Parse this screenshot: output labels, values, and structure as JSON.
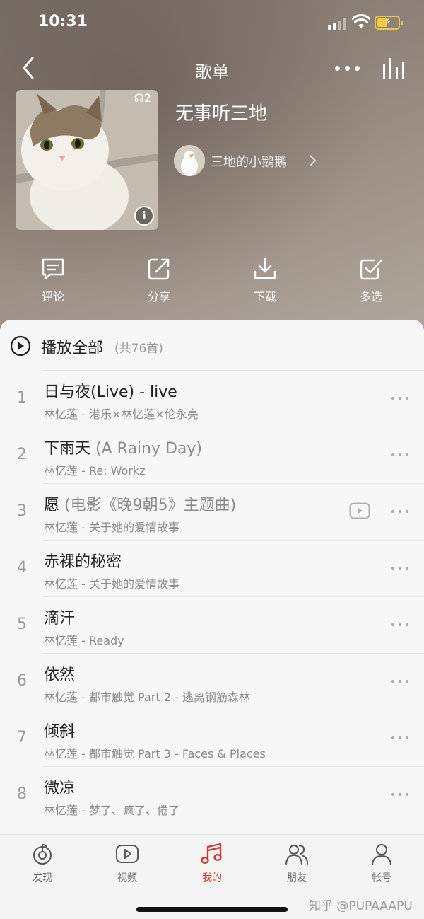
{
  "status": {
    "time": "10:31"
  },
  "nav": {
    "title": "歌单"
  },
  "playlist": {
    "title": "无事听三地",
    "play_count": "2",
    "creator": "三地的小鹅鹅"
  },
  "actions": [
    {
      "label": "评论",
      "icon": "comment-icon"
    },
    {
      "label": "分享",
      "icon": "share-icon"
    },
    {
      "label": "下载",
      "icon": "download-icon"
    },
    {
      "label": "多选",
      "icon": "multi-select-icon"
    }
  ],
  "list": {
    "play_all": "播放全部",
    "count": "(共76首)",
    "songs": [
      {
        "num": "1",
        "title": "日与夜(Live) - live",
        "extra": "",
        "sub": "林忆莲 - 港乐×林忆莲×伦永亮",
        "mv": false
      },
      {
        "num": "2",
        "title": "下雨天",
        "extra": " (A Rainy Day)",
        "sub": "林忆莲 - Re: Workz",
        "mv": false
      },
      {
        "num": "3",
        "title": "愿",
        "extra": " (电影《晚9朝5》主题曲)",
        "sub": "林忆莲 - 关于她的爱情故事",
        "mv": true
      },
      {
        "num": "4",
        "title": "赤裸的秘密",
        "extra": "",
        "sub": "林忆莲 - 关于她的爱情故事",
        "mv": false
      },
      {
        "num": "5",
        "title": "滴汗",
        "extra": "",
        "sub": "林忆莲 - Ready",
        "mv": false
      },
      {
        "num": "6",
        "title": "依然",
        "extra": "",
        "sub": "林忆莲 - 都市触觉 Part 2 - 逃离钢筋森林",
        "mv": false
      },
      {
        "num": "7",
        "title": "倾斜",
        "extra": "",
        "sub": "林忆莲 - 都市触觉 Part 3 - Faces & Places",
        "mv": false
      },
      {
        "num": "8",
        "title": "微凉",
        "extra": "",
        "sub": "林忆莲 - 梦了、疯了、倦了",
        "mv": false
      }
    ]
  },
  "tabs": [
    {
      "label": "发现",
      "icon": "discover-icon",
      "active": false
    },
    {
      "label": "视频",
      "icon": "video-icon",
      "active": false
    },
    {
      "label": "我的",
      "icon": "music-note-icon",
      "active": true
    },
    {
      "label": "朋友",
      "icon": "friends-icon",
      "active": false
    },
    {
      "label": "帐号",
      "icon": "account-icon",
      "active": false
    }
  ],
  "watermark": "知乎 @PUPAAAPU",
  "colors": {
    "accent": "#d33a31",
    "hero": "#8f8279",
    "text": "#222222",
    "secondary": "#8a8a8a"
  }
}
